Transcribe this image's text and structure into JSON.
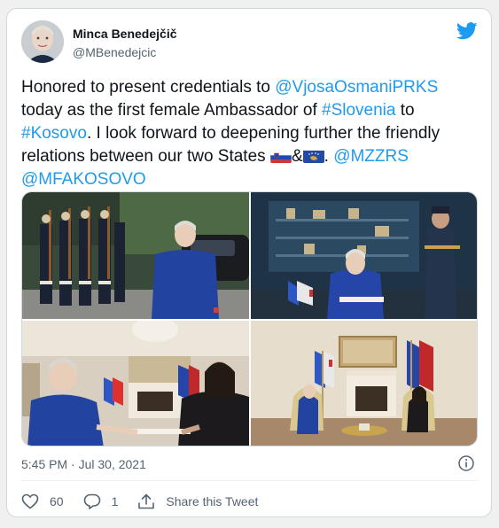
{
  "author": {
    "name": "Minca Benedejčič",
    "handle": "@MBenedejcic"
  },
  "tweet": {
    "part1": "Honored to present credentials to ",
    "mention1": "@VjosaOsmaniPRKS",
    "part2": " today as the first female Ambassador of ",
    "hashtag1": "#Slovenia",
    "part3": " to ",
    "hashtag2": "#Kosovo",
    "part4": ".  I look forward to deepening further the friendly relations between our two States ",
    "amp": "&",
    "part5": ". ",
    "mention2": "@MZZRS",
    "mention3": "@MFAKOSOVO"
  },
  "timestamp": "5:45 PM · Jul 30, 2021",
  "actions": {
    "likes": "60",
    "replies": "1",
    "share_label": "Share this Tweet"
  },
  "icons": {
    "brand": "twitter-bird-icon",
    "info": "info-icon",
    "like": "heart-icon",
    "reply": "reply-bubble-icon",
    "share": "share-icon"
  },
  "colors": {
    "link": "#1d9bf0",
    "twitter_blue": "#1d9bf0",
    "text": "#0f1419",
    "secondary": "#536471",
    "border": "#cfd9de"
  }
}
